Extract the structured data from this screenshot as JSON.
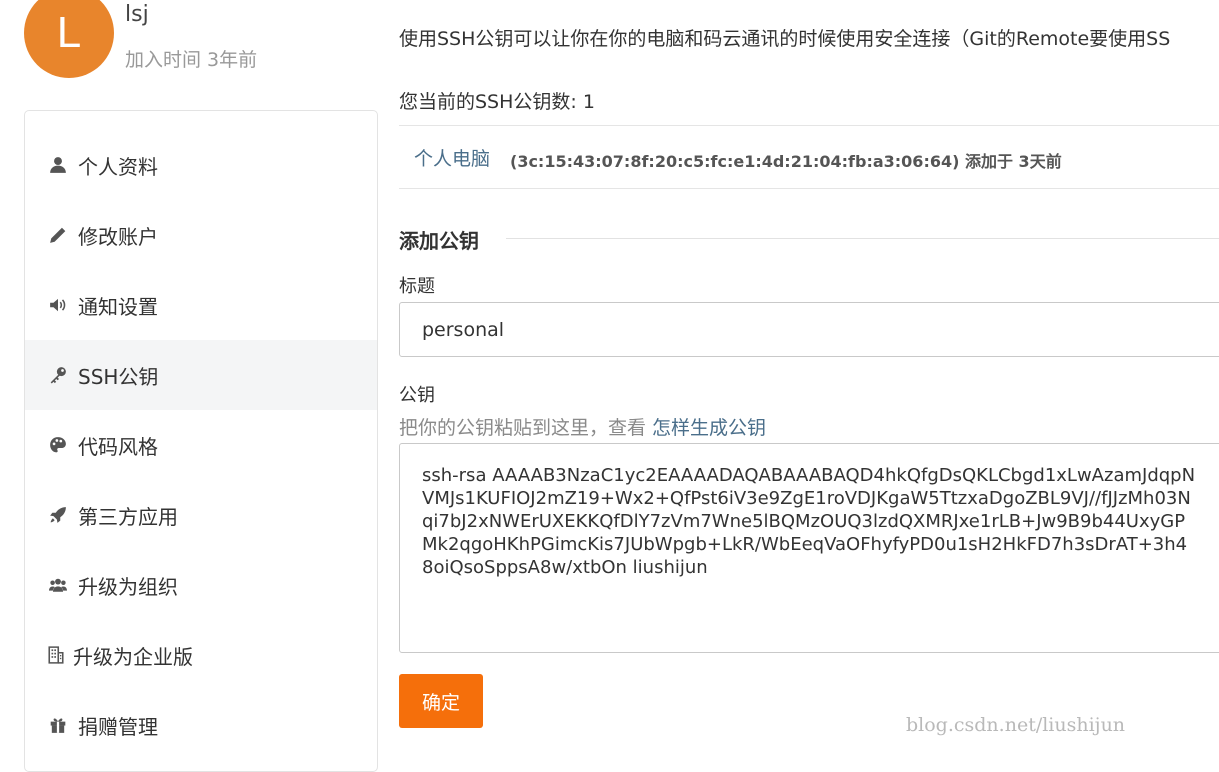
{
  "user": {
    "avatar_letter": "L",
    "avatar_color": "#e8852c",
    "name": "lsj",
    "joined": "加入时间 3年前"
  },
  "sidebar": {
    "items": [
      {
        "label": "个人资料",
        "icon": "user-icon"
      },
      {
        "label": "修改账户",
        "icon": "pencil-icon"
      },
      {
        "label": "通知设置",
        "icon": "speaker-icon"
      },
      {
        "label": "SSH公钥",
        "icon": "key-icon",
        "active": true
      },
      {
        "label": "代码风格",
        "icon": "palette-icon"
      },
      {
        "label": "第三方应用",
        "icon": "rocket-icon"
      },
      {
        "label": "升级为组织",
        "icon": "users-icon"
      },
      {
        "label": "升级为企业版",
        "icon": "building-icon"
      },
      {
        "label": "捐赠管理",
        "icon": "gift-icon"
      }
    ]
  },
  "main": {
    "intro": "使用SSH公钥可以让你在你的电脑和码云通讯的时候使用安全连接（Git的Remote要使用SS",
    "count_text": "您当前的SSH公钥数: 1",
    "keys": [
      {
        "title": "个人电脑",
        "meta": "(3c:15:43:07:8f:20:c5:fc:e1:4d:21:04:fb:a3:06:64) 添加于 3天前"
      }
    ],
    "add_section_title": "添加公钥",
    "title_label": "标题",
    "title_value": "personal",
    "key_label": "公钥",
    "key_hint": "把你的公钥粘贴到这里，查看 ",
    "key_hint_link": "怎样生成公钥",
    "key_value": "ssh-rsa AAAAB3NzaC1yc2EAAAADAQABAAABAQD4hkQfgDsQKLCbgd1xLwAzamJdqpN\nVMJs1KUFIOJ2mZ19+Wx2+QfPst6iV3e9ZgE1roVDJKgaW5TtzxaDgoZBL9VJ//fJJzMh03N\nqi7bJ2xNWErUXEKKQfDlY7zVm7Wne5lBQMzOUQ3lzdQXMRJxe1rLB+Jw9B9b44UxyGP\nMk2qgoHKhPGimcKis7JUbWpgb+LkR/WbEeqVaOFhyfyPD0u1sH2HkFD7h3sDrAT+3h4\n8oiQsoSppsA8w/xtbOn liushijun",
    "submit_label": "确定",
    "accent_color": "#f56f0b"
  },
  "watermark": "blog.csdn.net/liushijun"
}
